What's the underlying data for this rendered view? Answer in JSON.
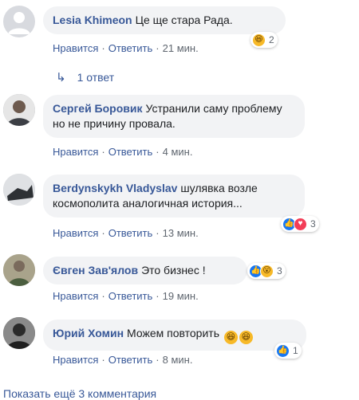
{
  "actions": {
    "like": "Нравится",
    "reply": "Ответить",
    "separator": "·"
  },
  "comments": [
    {
      "author": "Lesia Khimeon",
      "text": "Це ще стара Рада.",
      "time": "21 мин.",
      "reactions": {
        "icons": [
          "haha"
        ],
        "count": "2"
      }
    },
    {
      "author": "Сергей Боровик",
      "text": "Устранили саму проблему но не причину провала.",
      "time": "4 мин."
    },
    {
      "author": "Berdynskykh Vladyslav",
      "text": "шулявка возле космополита аналогичная история...",
      "time": "13 мин.",
      "reactions": {
        "icons": [
          "like",
          "love"
        ],
        "count": "3"
      }
    },
    {
      "author": "Євген Зав'ялов",
      "text": "Это бизнес !",
      "time": "19 мин.",
      "reactions": {
        "icons": [
          "like",
          "wow"
        ],
        "count": "3"
      }
    },
    {
      "author": "Юрий Хомин",
      "text": "Можем повторить",
      "text_emoji": [
        "laughing-face",
        "laughing-face"
      ],
      "time": "8 мин.",
      "reactions": {
        "icons": [
          "like"
        ],
        "count": "1"
      }
    }
  ],
  "replies_link": {
    "icon": "reply-arrow-icon",
    "label": "1 ответ"
  },
  "more_comments": "Показать ещё 3 комментария",
  "colors": {
    "link": "#385898",
    "bubble": "#f2f3f5",
    "meta": "#606770",
    "like": "#1877f2",
    "love": "#f33e58",
    "haha": "#f7b928"
  }
}
